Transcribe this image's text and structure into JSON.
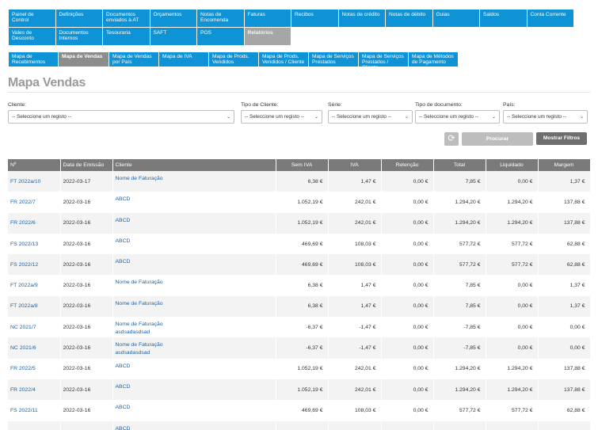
{
  "topnav": {
    "row1": [
      "Painel de Control",
      "Definições",
      "Documentos enviados à AT",
      "Orçamentos",
      "Notas de Encomenda",
      "Faturas",
      "Recibos",
      "Notas de crédito",
      "Notas de débito",
      "Guias",
      "Saldos",
      "Conta Corrente"
    ],
    "row2": [
      "Vales de Desconto",
      "Documentos Internos",
      "Tesouraria",
      "SAFT",
      "POS",
      "Relatórios"
    ],
    "active": "Relatórios"
  },
  "subnav": {
    "items": [
      "Mapa de Recebimentos",
      "Mapa de Vendas",
      "Mapa de Vendas por País",
      "Mapa de IVA",
      "Mapa de Prods. Vendidos",
      "Mapa de Prods. Vendidos / Cliente",
      "Mapa de Serviços Prestados",
      "Mapa de Serviços Prestados / Cliente",
      "Mapa de Métodos de Pagamento"
    ],
    "active": "Mapa de Vendas"
  },
  "page": {
    "title": "Mapa Vendas"
  },
  "filters": {
    "cliente": {
      "label": "Cliente:",
      "value": "-- Seleccione um registo --"
    },
    "tipo_cliente": {
      "label": "Tipo de Cliente:",
      "value": "-- Seleccione um registo --"
    },
    "serie": {
      "label": "Série:",
      "value": "-- Seleccione um registo --"
    },
    "tipo_documento": {
      "label": "Tipo de documento:",
      "value": "-- Seleccione um registo --"
    },
    "pais": {
      "label": "País:",
      "value": "-- Seleccione um registo --"
    }
  },
  "buttons": {
    "refresh_icon": "refresh-icon",
    "procurar": "Procurar",
    "mostrar_filtros": "Mostrar Filtros"
  },
  "table": {
    "headers": [
      "Nº",
      "Data de Emissão",
      "Cliente",
      "Sem IVA",
      "IVA",
      "Retenção",
      "Total",
      "Liquidado",
      "Margem"
    ],
    "rows": [
      [
        "FT 2022a/10",
        "2022-03-17",
        "Nome de Faturação",
        "",
        "6,38 €",
        "1,47 €",
        "0,00 €",
        "7,85 €",
        "0,00 €",
        "1,37 €"
      ],
      [
        "FR 2022/7",
        "2022-03-16",
        "ABCD",
        "",
        "1.052,19 €",
        "242,01 €",
        "0,00 €",
        "1.294,20 €",
        "1.294,20 €",
        "137,88 €"
      ],
      [
        "FR 2022/6",
        "2022-03-16",
        "ABCD",
        "",
        "1.052,19 €",
        "242,01 €",
        "0,00 €",
        "1.294,20 €",
        "1.294,20 €",
        "137,88 €"
      ],
      [
        "FS 2022/13",
        "2022-03-16",
        "ABCD",
        "",
        "469,69 €",
        "108,03 €",
        "0,00 €",
        "577,72 €",
        "577,72 €",
        "62,88 €"
      ],
      [
        "FS 2022/12",
        "2022-03-16",
        "ABCD",
        "",
        "469,69 €",
        "108,03 €",
        "0,00 €",
        "577,72 €",
        "577,72 €",
        "62,88 €"
      ],
      [
        "FT 2022a/9",
        "2022-03-16",
        "Nome de Faturação",
        "",
        "6,38 €",
        "1,47 €",
        "0,00 €",
        "7,85 €",
        "0,00 €",
        "1,37 €"
      ],
      [
        "FT 2022a/8",
        "2022-03-16",
        "Nome de Faturação",
        "",
        "6,38 €",
        "1,47 €",
        "0,00 €",
        "7,85 €",
        "0,00 €",
        "1,37 €"
      ],
      [
        "NC 2021/7",
        "2022-03-16",
        "Nome de Faturação",
        "asdsadasdsad",
        "-6,37 €",
        "-1,47 €",
        "0,00 €",
        "-7,85 €",
        "0,00 €",
        "0,00 €"
      ],
      [
        "NC 2021/6",
        "2022-03-16",
        "Nome de Faturação",
        "asdsadasdsad",
        "-6,37 €",
        "-1,47 €",
        "0,00 €",
        "-7,85 €",
        "0,00 €",
        "0,00 €"
      ],
      [
        "FR 2022/5",
        "2022-03-16",
        "ABCD",
        "",
        "1.052,19 €",
        "242,01 €",
        "0,00 €",
        "1.294,20 €",
        "1.294,20 €",
        "137,88 €"
      ],
      [
        "FR 2022/4",
        "2022-03-16",
        "ABCD",
        "",
        "1.052,19 €",
        "242,01 €",
        "0,00 €",
        "1.294,20 €",
        "1.294,20 €",
        "137,88 €"
      ],
      [
        "FS 2022/11",
        "2022-03-16",
        "ABCD",
        "",
        "469,69 €",
        "108,03 €",
        "0,00 €",
        "577,72 €",
        "577,72 €",
        "62,88 €"
      ],
      [
        "",
        "",
        "ABCD",
        "",
        "",
        "",
        "",
        "",
        "",
        ""
      ]
    ]
  }
}
